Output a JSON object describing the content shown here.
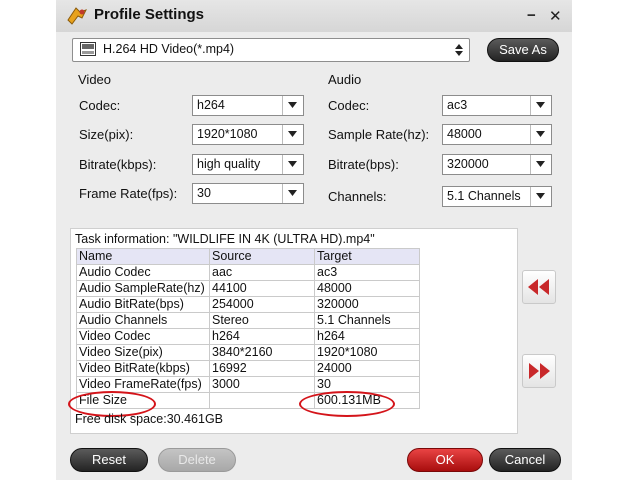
{
  "window": {
    "title": "Profile Settings"
  },
  "preset": {
    "value": "H.264 HD Video(*.mp4)",
    "save_as": "Save As"
  },
  "video": {
    "heading": "Video",
    "fields": [
      {
        "label": "Codec:",
        "value": "h264"
      },
      {
        "label": "Size(pix):",
        "value": "1920*1080"
      },
      {
        "label": "Bitrate(kbps):",
        "value": "high quality"
      },
      {
        "label": "Frame Rate(fps):",
        "value": "30"
      }
    ]
  },
  "audio": {
    "heading": "Audio",
    "fields": [
      {
        "label": "Codec:",
        "value": "ac3"
      },
      {
        "label": "Sample Rate(hz):",
        "value": "48000"
      },
      {
        "label": "Bitrate(bps):",
        "value": "320000"
      },
      {
        "label": "Channels:",
        "value": "5.1 Channels"
      }
    ]
  },
  "task": {
    "info": "Task information: \"WILDLIFE IN 4K (ULTRA HD).mp4\"",
    "columns": [
      "Name",
      "Source",
      "Target"
    ],
    "rows": [
      [
        "Audio Codec",
        "aac",
        "ac3"
      ],
      [
        "Audio SampleRate(hz)",
        "44100",
        "48000"
      ],
      [
        "Audio BitRate(bps)",
        "254000",
        "320000"
      ],
      [
        "Audio Channels",
        "Stereo",
        "5.1 Channels"
      ],
      [
        "Video Codec",
        "h264",
        "h264"
      ],
      [
        "Video Size(pix)",
        "3840*2160",
        "1920*1080"
      ],
      [
        "Video BitRate(kbps)",
        "16992",
        "24000"
      ],
      [
        "Video FrameRate(fps)",
        "3000",
        "30"
      ],
      [
        "File Size",
        "",
        "600.131MB"
      ]
    ],
    "free_space": "Free disk space:30.461GB"
  },
  "buttons": {
    "reset": "Reset",
    "delete": "Delete",
    "ok": "OK",
    "cancel": "Cancel"
  },
  "colors": {
    "accent_red": "#d4141a",
    "button_dark": "#2a2a2a",
    "ok_red": "#c81414"
  },
  "icons": [
    "logo-icon",
    "minimize-icon",
    "close-icon",
    "video-format-icon",
    "rewind-icon",
    "fast-forward-icon"
  ]
}
